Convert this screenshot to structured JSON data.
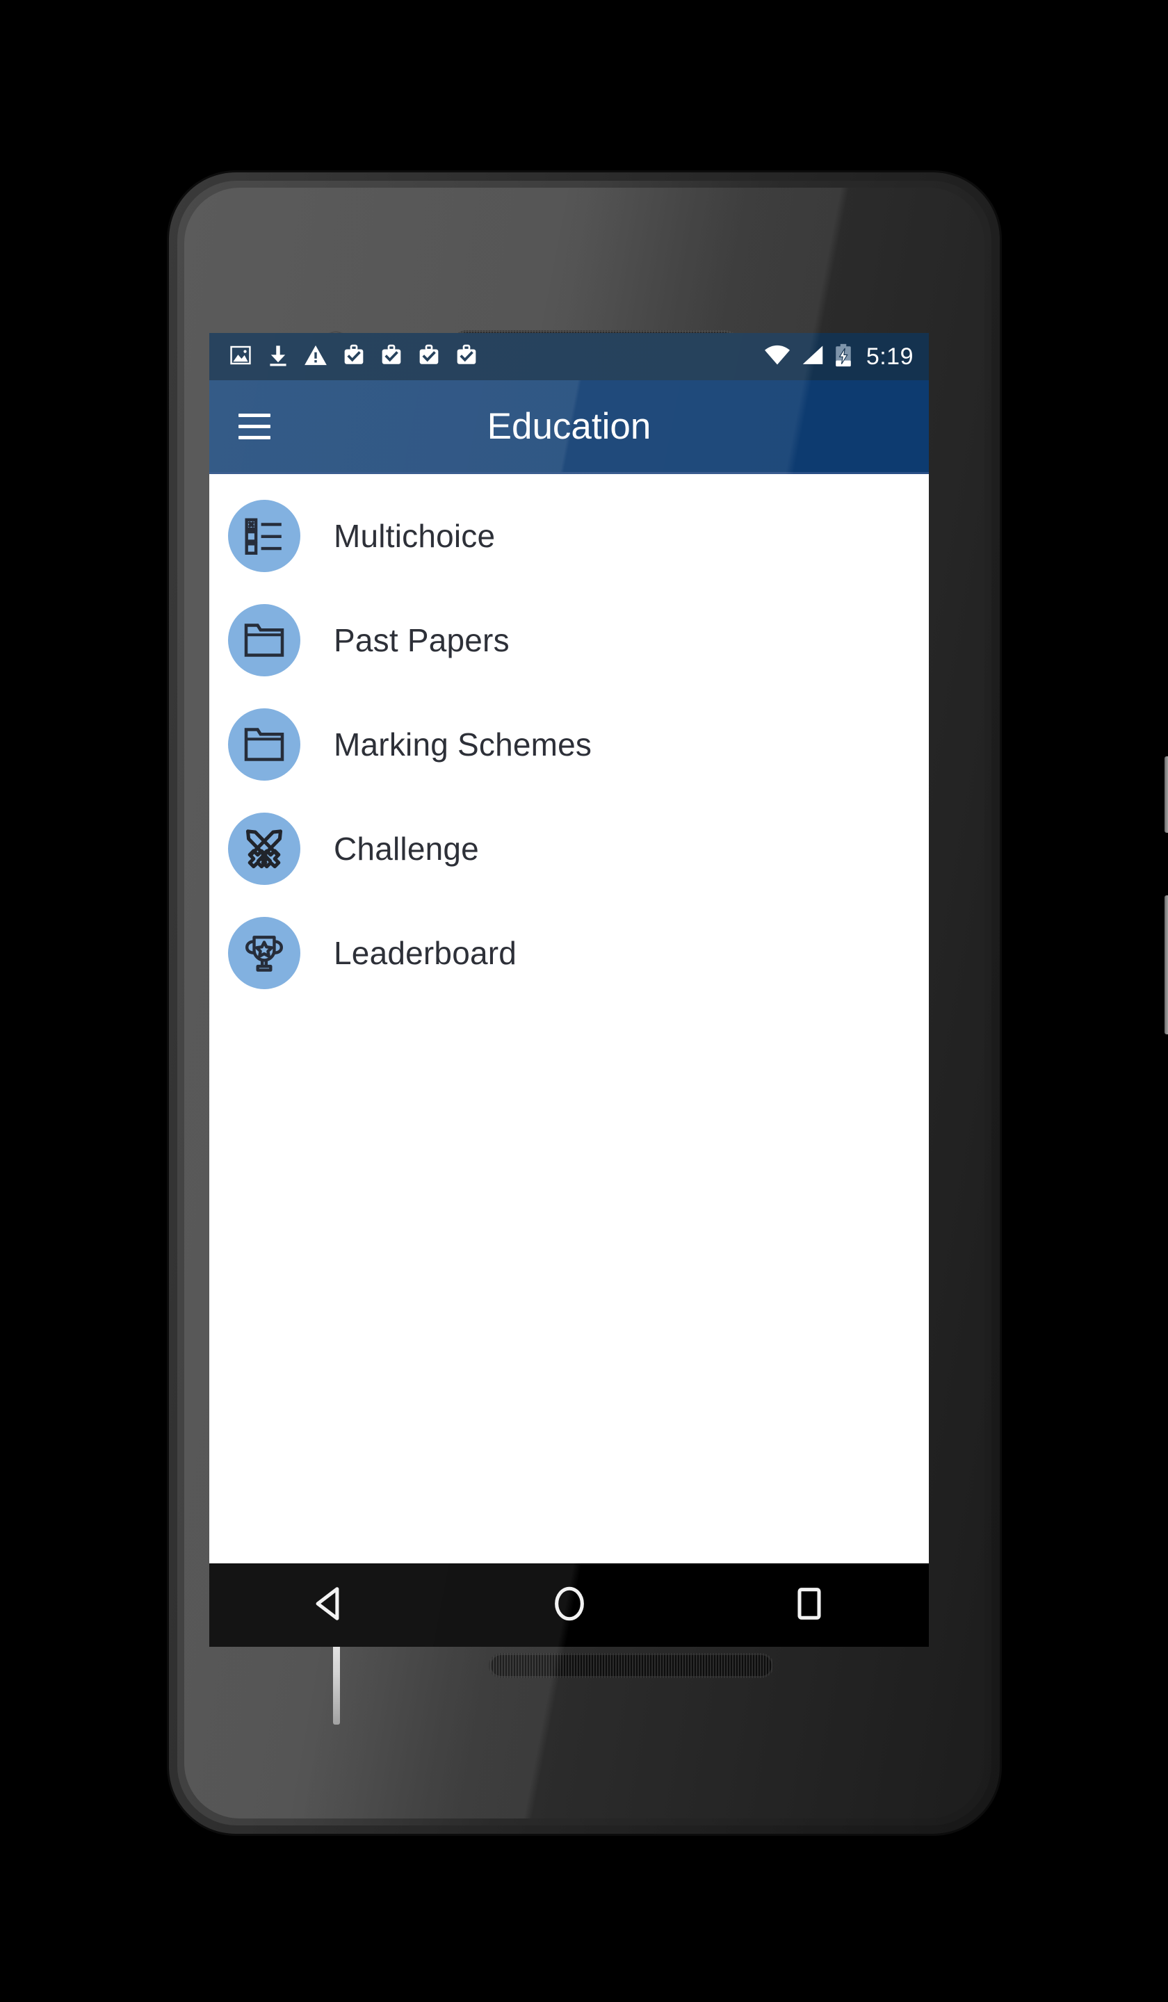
{
  "device": {
    "name": "android-phone-mockup",
    "parts": {
      "front_camera": "front-camera-icon",
      "earpiece": "earpiece-speaker",
      "bottom_speaker": "bottom-speaker",
      "power_button": "power-button",
      "volume_button": "volume-button"
    }
  },
  "statusbar": {
    "background_color": "#14324f",
    "time": "5:19",
    "left_icons": [
      {
        "name": "image-icon",
        "glyph": "photo"
      },
      {
        "name": "download-icon",
        "glyph": "download"
      },
      {
        "name": "warning-icon",
        "glyph": "warning-triangle"
      },
      {
        "name": "work-profile-icon-1",
        "glyph": "briefcase-check"
      },
      {
        "name": "work-profile-icon-2",
        "glyph": "briefcase-check"
      },
      {
        "name": "work-profile-icon-3",
        "glyph": "briefcase-check"
      },
      {
        "name": "work-profile-icon-4",
        "glyph": "briefcase-check"
      }
    ],
    "right_icons": [
      {
        "name": "wifi-icon",
        "glyph": "wifi-full"
      },
      {
        "name": "cellular-signal-icon",
        "glyph": "signal-triangle"
      },
      {
        "name": "battery-charging-icon",
        "glyph": "battery-bolt"
      }
    ]
  },
  "appbar": {
    "title": "Education",
    "background_color": "#0d3b70",
    "menu_icon": "hamburger-menu-icon"
  },
  "list": {
    "accent_color": "#77aadd",
    "text_color": "#1b1e27",
    "items": [
      {
        "label": "Multichoice",
        "icon": "multichoice-checklist-icon"
      },
      {
        "label": "Past Papers",
        "icon": "folder-icon"
      },
      {
        "label": "Marking Schemes",
        "icon": "folder-icon"
      },
      {
        "label": "Challenge",
        "icon": "crossed-swords-icon"
      },
      {
        "label": "Leaderboard",
        "icon": "trophy-star-icon"
      }
    ]
  },
  "navbar": {
    "background_color": "#000000",
    "buttons": [
      {
        "name": "back-button",
        "icon": "back-triangle-icon"
      },
      {
        "name": "home-button",
        "icon": "home-circle-icon"
      },
      {
        "name": "recents-button",
        "icon": "recents-square-icon"
      }
    ]
  }
}
